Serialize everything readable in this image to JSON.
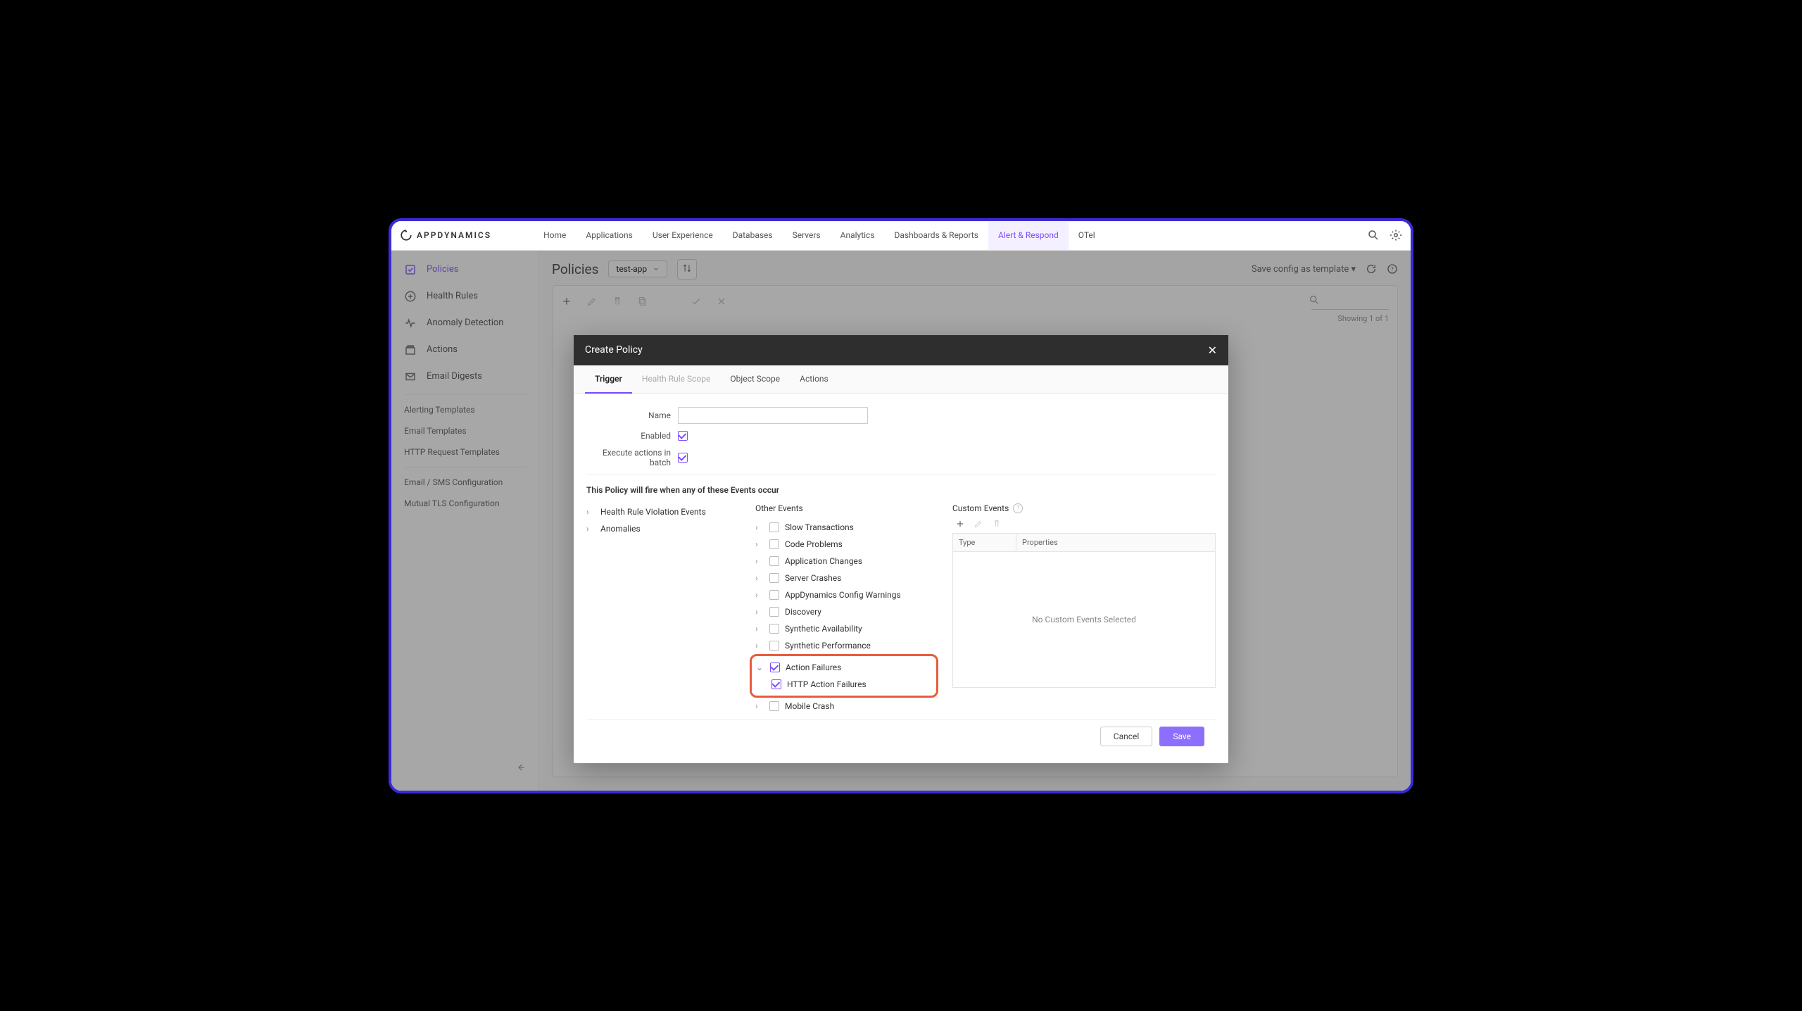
{
  "brand": "APPDYNAMICS",
  "topnav": [
    "Home",
    "Applications",
    "User Experience",
    "Databases",
    "Servers",
    "Analytics",
    "Dashboards & Reports",
    "Alert & Respond",
    "OTel"
  ],
  "topnav_active": 7,
  "sidebar": {
    "primary": [
      {
        "label": "Policies",
        "icon": "check-square",
        "active": true
      },
      {
        "label": "Health Rules",
        "icon": "plus-circle"
      },
      {
        "label": "Anomaly Detection",
        "icon": "pulse"
      },
      {
        "label": "Actions",
        "icon": "clapper"
      },
      {
        "label": "Email Digests",
        "icon": "mail"
      }
    ],
    "secondary1": [
      "Alerting Templates",
      "Email Templates",
      "HTTP Request Templates"
    ],
    "secondary2": [
      "Email / SMS Configuration",
      "Mutual TLS Configuration"
    ]
  },
  "page": {
    "title": "Policies",
    "app": "test-app",
    "save_template": "Save config as template",
    "showing": "Showing 1 of 1"
  },
  "modal": {
    "title": "Create Policy",
    "tabs": [
      "Trigger",
      "Health Rule Scope",
      "Object Scope",
      "Actions"
    ],
    "tab_active": 0,
    "tab_disabled": 1,
    "form": {
      "name_label": "Name",
      "name_value": "",
      "enabled_label": "Enabled",
      "enabled": true,
      "batch_label": "Execute actions in batch",
      "batch": true
    },
    "section_title": "This Policy will fire when any of these Events occur",
    "left_tree": [
      "Health Rule Violation Events",
      "Anomalies"
    ],
    "other_head": "Other Events",
    "other_events": [
      {
        "label": "Slow Transactions",
        "checked": false,
        "expanded": false
      },
      {
        "label": "Code Problems",
        "checked": false,
        "expanded": false
      },
      {
        "label": "Application Changes",
        "checked": false,
        "expanded": false
      },
      {
        "label": "Server Crashes",
        "checked": false,
        "expanded": false
      },
      {
        "label": "AppDynamics Config Warnings",
        "checked": false,
        "expanded": false
      },
      {
        "label": "Discovery",
        "checked": false,
        "expanded": false
      },
      {
        "label": "Synthetic Availability",
        "checked": false,
        "expanded": false
      },
      {
        "label": "Synthetic Performance",
        "checked": false,
        "expanded": false
      },
      {
        "label": "Action Failures",
        "checked": true,
        "expanded": true,
        "highlighted": true,
        "children": [
          {
            "label": "HTTP Action Failures",
            "checked": true
          }
        ]
      },
      {
        "label": "Mobile Crash",
        "checked": false,
        "expanded": false
      }
    ],
    "custom_head": "Custom Events",
    "custom_table": {
      "type_col": "Type",
      "props_col": "Properties",
      "empty": "No Custom Events Selected"
    },
    "buttons": {
      "cancel": "Cancel",
      "save": "Save"
    }
  }
}
